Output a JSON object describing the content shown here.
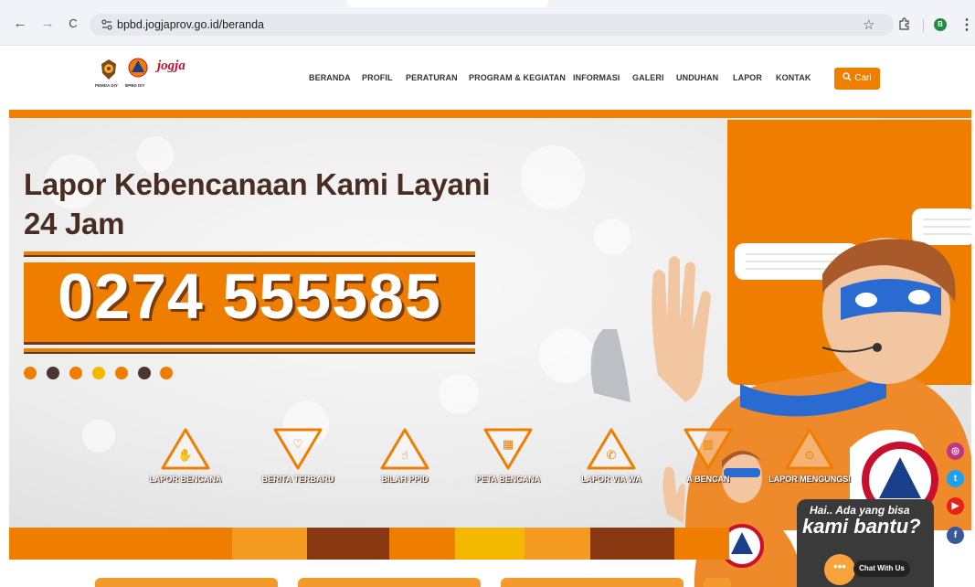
{
  "browser": {
    "url": "bpbd.jogjaprov.go.id/beranda",
    "back_icon": "←",
    "forward_icon": "→",
    "reload_icon": "C",
    "star_icon": "☆",
    "profile_initial": "B",
    "menu_icon": "⋮"
  },
  "site": {
    "logos": {
      "pemda": "PEMDA DIY",
      "bpbd": "BPBD DIY",
      "jogja": "jogja"
    },
    "nav": [
      "BERANDA",
      "PROFIL",
      "PERATURAN",
      "PROGRAM & KEGIATAN",
      "INFORMASI",
      "GALERI",
      "UNDUHAN",
      "LAPOR",
      "KONTAK"
    ],
    "search_label": "Cari"
  },
  "hero": {
    "headline_line1": "Lapor Kebencanaan Kami Layani",
    "headline_line2": "24 Jam",
    "phone": "0274 555585",
    "carousel_dots": [
      "#ef7d00",
      "#4a3530",
      "#ef7d00",
      "#f5b800",
      "#ef7d00",
      "#4a3530",
      "#ef7d00"
    ]
  },
  "services": [
    {
      "label": "LAPOR BENCANA",
      "icon": "hand-icon"
    },
    {
      "label": "BERITA TERBARU",
      "icon": "handshake-icon"
    },
    {
      "label": "BILAH PPID",
      "icon": "pointer-icon"
    },
    {
      "label": "PETA BENCANA",
      "icon": "map-icon"
    },
    {
      "label": "LAPOR VIA WA",
      "icon": "whatsapp-icon"
    },
    {
      "label": "A BENCAN",
      "icon": "chart-icon"
    },
    {
      "label": "LAPOR MENGUNGSI",
      "icon": "location-icon"
    }
  ],
  "chat": {
    "line1": "Hai.. Ada yang bisa",
    "line2": "kami bantu?",
    "button": "Chat With Us",
    "bubble": "•••"
  },
  "colors": {
    "brand_orange": "#ef7d00",
    "dark_brown": "#4a2d22"
  }
}
